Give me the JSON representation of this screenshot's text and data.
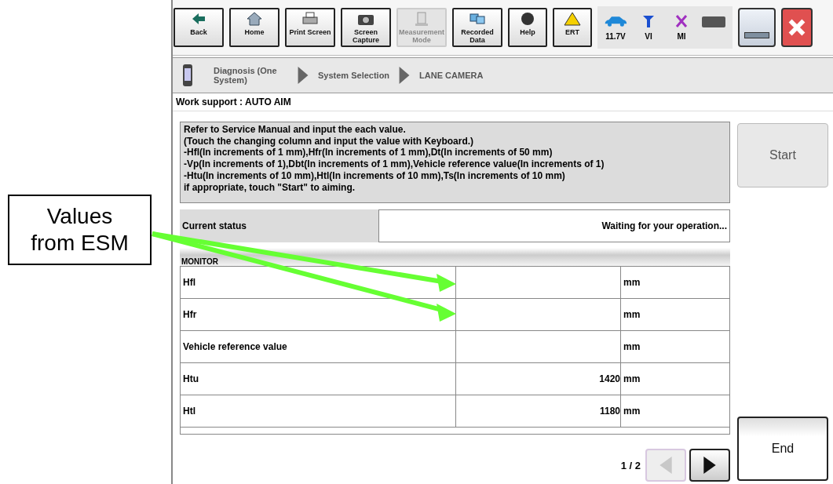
{
  "callout": {
    "text": "Values from ESM"
  },
  "toolbar": [
    {
      "label": "Back",
      "disabled": false
    },
    {
      "label": "Home",
      "disabled": false
    },
    {
      "label": "Print Screen",
      "disabled": false
    },
    {
      "label": "Screen Capture",
      "disabled": false
    },
    {
      "label": "Measurement Mode",
      "disabled": true
    },
    {
      "label": "Recorded Data",
      "disabled": false
    },
    {
      "label": "Help",
      "disabled": false
    },
    {
      "label": "ERT",
      "disabled": false
    }
  ],
  "status_indicators": [
    {
      "label": "11.7V"
    },
    {
      "label": "VI"
    },
    {
      "label": "MI"
    }
  ],
  "breadcrumb": [
    "Diagnosis (One System)",
    "System Selection",
    "LANE CAMERA"
  ],
  "title": "Work support : AUTO AIM",
  "instructions": [
    "Refer to Service Manual and input the each value.",
    "(Touch the changing column and input the value with Keyboard.)",
    "-Hfl(In increments of 1 mm),Hfr(In increments of 1 mm),Dt(In increments of 50 mm)",
    "-Vp(In increments of 1),Dbt(In increments of 1 mm),Vehicle reference value(In increments of 1)",
    "-Htu(In increments of 10 mm),Htl(In increments of 10 mm),Ts(In increments of 10 mm)",
    "if appropriate, touch \"Start\" to aiming."
  ],
  "status": {
    "label": "Current status",
    "value": "Waiting for your operation..."
  },
  "monitor": {
    "header": "MONITOR",
    "rows": [
      {
        "name": "Hfl",
        "unit": "mm"
      },
      {
        "name": "Hfr",
        "unit": "mm"
      },
      {
        "name": "Vehicle reference value",
        "unit": "mm"
      },
      {
        "name": "Htu",
        "value": "1420",
        "unit": "mm"
      },
      {
        "name": "Htl",
        "value": "1180",
        "unit": "mm"
      }
    ]
  },
  "pager": {
    "text": "1 / 2",
    "prev_disabled": true,
    "next_disabled": false
  },
  "start_button": {
    "label": "Start",
    "disabled": true
  },
  "end_button": {
    "label": "End",
    "disabled": false
  }
}
